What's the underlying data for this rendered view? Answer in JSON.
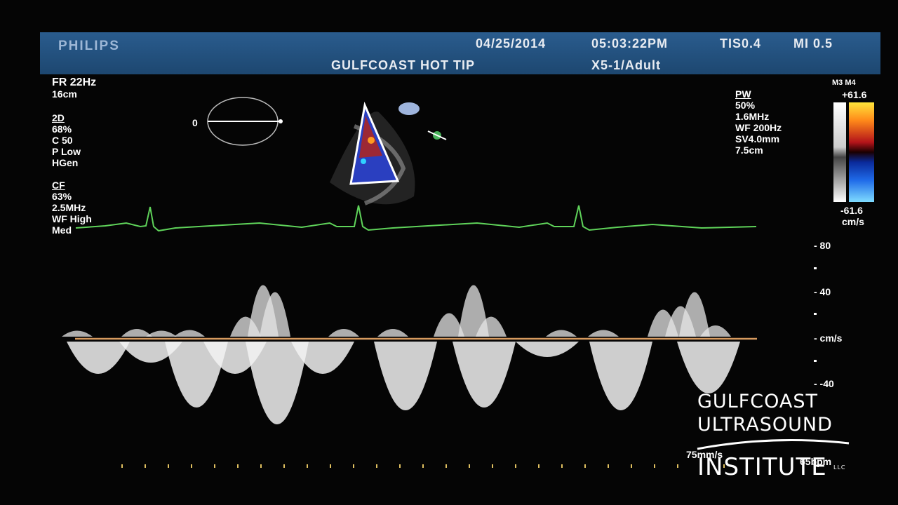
{
  "header": {
    "brand": "PHILIPS",
    "date": "04/25/2014",
    "time": "05:03:22PM",
    "tis": "TIS0.4",
    "mi": "MI 0.5",
    "title": "GULFCOAST HOT TIP",
    "probe": "X5-1/Adult"
  },
  "params_left": {
    "fr": "FR 22Hz",
    "depth": "16cm",
    "twod": {
      "heading": "2D",
      "lines": [
        "68%",
        "C 50",
        "P Low",
        "HGen"
      ]
    },
    "cf": {
      "heading": "CF",
      "lines": [
        "63%",
        "2.5MHz",
        "WF High",
        "Med"
      ]
    }
  },
  "params_right": {
    "heading": "PW",
    "lines": [
      "50%",
      "1.6MHz",
      "WF 200Hz",
      "SV4.0mm",
      "7.5cm"
    ]
  },
  "color_map": {
    "label": "M3 M4",
    "top": "+61.6",
    "bottom": "-61.6",
    "unit": "cm/s"
  },
  "doppler_scale": {
    "ticks": [
      "- 80",
      "- 40",
      "- cm/s",
      "- -40"
    ],
    "sweep": "75mm/s",
    "hr": "65bpm"
  },
  "ellipse_label": "0",
  "colors": {
    "header": "#2a5c8e",
    "ecg": "#5fd35a",
    "baseline": "#d79a5e"
  },
  "logo": {
    "line1": "GULFCOAST",
    "line2": "ULTRASOUND",
    "line3": "INSTITUTE",
    "mark": "LLC"
  }
}
